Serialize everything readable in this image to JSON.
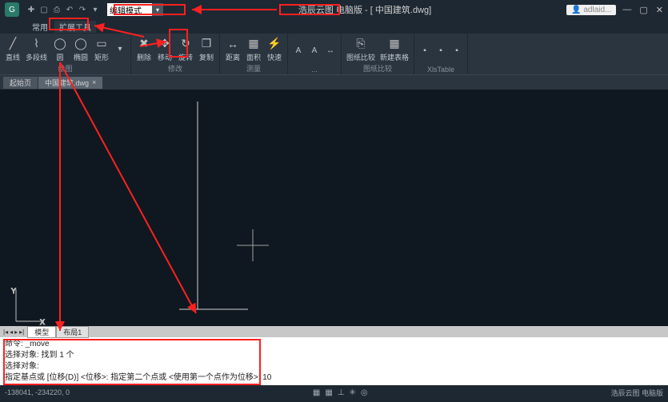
{
  "titlebar": {
    "search_value": "编辑模式",
    "app_name": "浩辰云图 电脑版",
    "file_name": "中国建筑.dwg]",
    "user": "adlaid..."
  },
  "menu": {
    "tabs": [
      "常用",
      "扩展工具"
    ]
  },
  "ribbon": {
    "draw": {
      "title": "绘图",
      "btns": [
        "直线",
        "多段线",
        "圆",
        "椭圆",
        "矩形"
      ]
    },
    "modify": {
      "title": "修改",
      "btns": [
        "删除",
        "移动",
        "旋转",
        "复制"
      ]
    },
    "measure": {
      "title": "测量",
      "btns": [
        "距离",
        "面积",
        "快速"
      ]
    },
    "dim": {
      "title": "...",
      "btns": [
        "..."
      ]
    },
    "compare": {
      "title": "图纸比较",
      "btns": [
        "图纸比较",
        "新建表格"
      ]
    },
    "xls": {
      "title": "XlsTable"
    }
  },
  "doctabs": {
    "tabs": [
      "起始页",
      "中国建筑.dwg"
    ]
  },
  "bottomtabs": {
    "tabs": [
      "模型",
      "布局1"
    ]
  },
  "cmd": {
    "l1": "命令: _move",
    "l2": "选择对象: 找到 1 个",
    "l3": "选择对象:",
    "l4": "指定基点或 [位移(D)] <位移>:   指定第二个点或 <使用第一个点作为位移>: 10"
  },
  "status": {
    "coords": "-138041, -234220, 0",
    "right": "浩辰云图 电脑版"
  }
}
